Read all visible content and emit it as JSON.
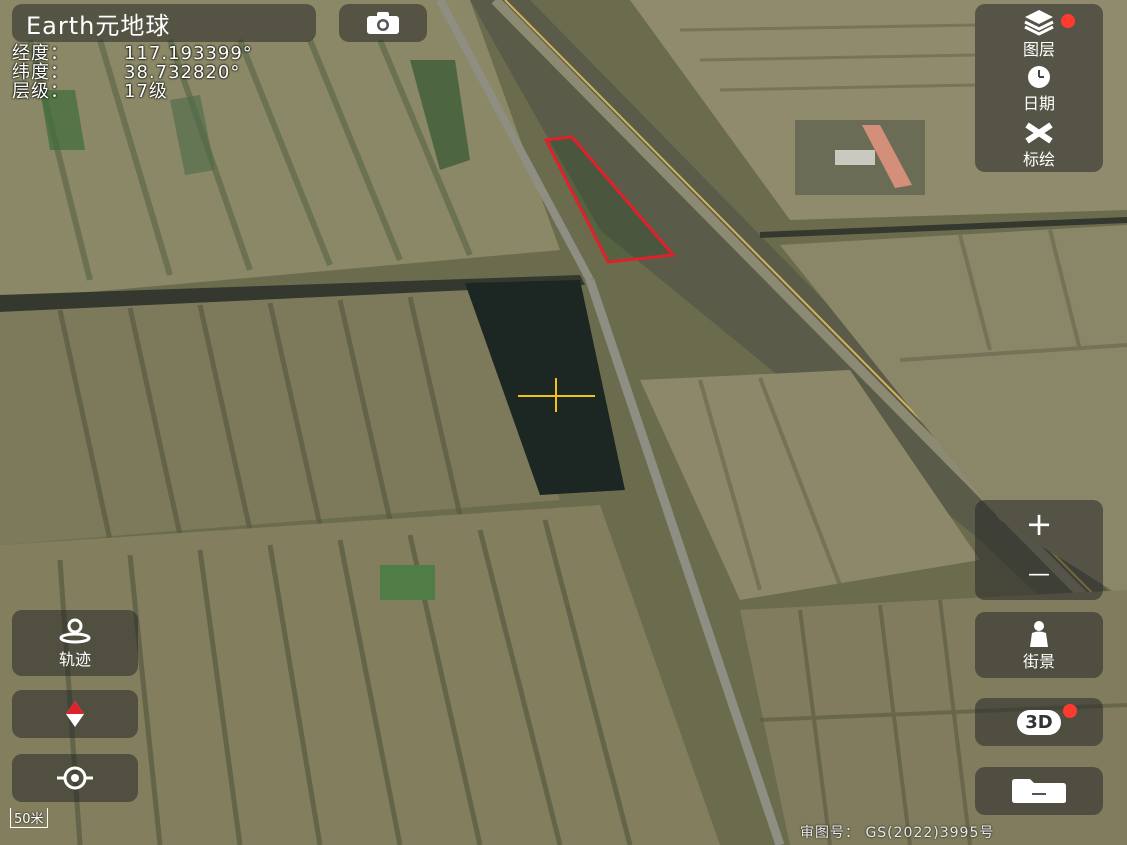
{
  "app_title": "Earth元地球",
  "coordinates": {
    "lon_label": "经度：",
    "lon_value": "117.193399°",
    "lat_label": "纬度：",
    "lat_value": "38.732820°",
    "level_label": "层级：",
    "level_value": "17级"
  },
  "right_toolbar": {
    "layers_label": "图层",
    "date_label": "日期",
    "draw_label": "标绘"
  },
  "zoom": {
    "in_symbol": "+",
    "out_symbol": "—"
  },
  "street_view_label": "街景",
  "three_d_label": "3D",
  "track_label": "轨迹",
  "scale_text": "50米",
  "approval_text": "审图号：  GS(2022)3995号",
  "icons": [
    "camera-icon",
    "layers-icon",
    "calendar-clock-icon",
    "ruler-pencil-icon",
    "person-icon",
    "folder-icon",
    "track-icon",
    "compass-icon",
    "locate-icon"
  ],
  "colors": {
    "accent_red": "#ff3b30",
    "polygon_outline": "#e0202a",
    "crosshair": "#f2c21a"
  }
}
